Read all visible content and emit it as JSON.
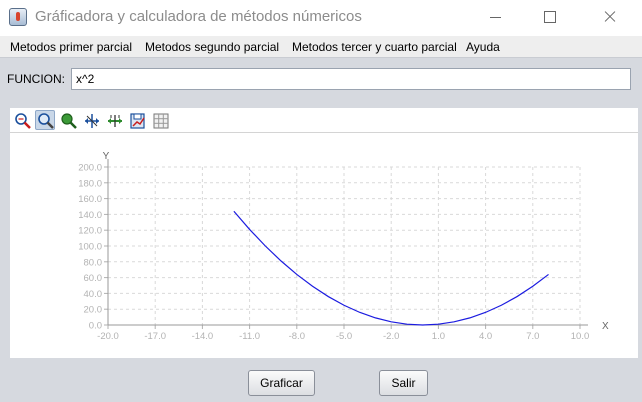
{
  "window": {
    "title": "Gráficadora y calculadora de métodos númericos",
    "icon": "java-cup-icon"
  },
  "menubar": {
    "items": [
      {
        "label": "Metodos primer parcial"
      },
      {
        "label": "Metodos segundo parcial"
      },
      {
        "label": "Metodos tercer y cuarto parcial"
      },
      {
        "label": "Ayuda"
      }
    ]
  },
  "function": {
    "label": "FUNCION:",
    "value": "x^2"
  },
  "toolbar": {
    "icons": [
      "zoom-region-icon",
      "zoom-icon",
      "center-icon",
      "move-axes-icon",
      "scale-axes-icon",
      "save-image-icon",
      "grid-toggle-icon"
    ]
  },
  "chart_data": {
    "type": "line",
    "title": "",
    "xlabel": "X",
    "ylabel": "Y",
    "xlim": [
      -20.0,
      10.0
    ],
    "ylim": [
      0.0,
      200.0
    ],
    "grid": true,
    "x_ticks": [
      "-20.0",
      "-17.0",
      "-14.0",
      "-11.0",
      "-8.0",
      "-5.0",
      "-2.0",
      "1.0",
      "4.0",
      "7.0",
      "10.0"
    ],
    "y_ticks": [
      "0.0",
      "20.0",
      "40.0",
      "60.0",
      "80.0",
      "100.0",
      "120.0",
      "140.0",
      "160.0",
      "180.0",
      "200.0"
    ],
    "series": [
      {
        "color": "#1c1ce0",
        "x": [
          -12.0,
          -11.0,
          -10.0,
          -9.0,
          -8.0,
          -7.0,
          -6.0,
          -5.0,
          -4.0,
          -3.0,
          -2.0,
          -1.0,
          0.0,
          1.0,
          2.0,
          3.0,
          4.0,
          5.0,
          6.0,
          7.0,
          8.0
        ],
        "y": [
          144,
          121,
          100,
          81,
          64,
          49,
          36,
          25,
          16,
          9,
          4,
          1,
          0,
          1,
          4,
          9,
          16,
          25,
          36,
          49,
          64
        ]
      }
    ]
  },
  "buttons": {
    "graph": "Graficar",
    "exit": "Salir"
  }
}
